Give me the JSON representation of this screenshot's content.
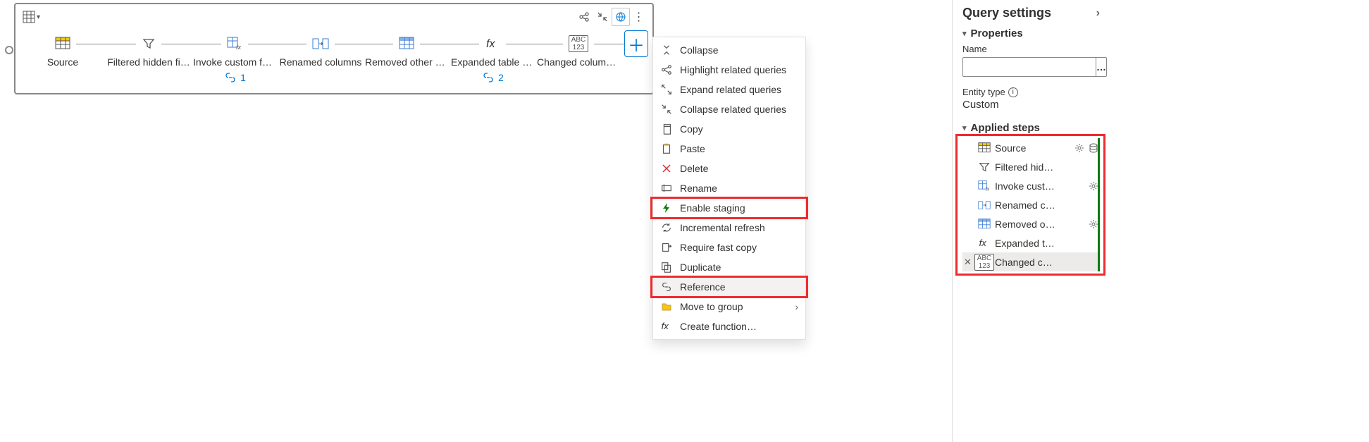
{
  "diagram": {
    "steps": [
      {
        "label": "Source",
        "icon": "table-yellow"
      },
      {
        "label": "Filtered hidden fi…",
        "icon": "filter"
      },
      {
        "label": "Invoke custom fu…",
        "icon": "table-fx",
        "badge": "1"
      },
      {
        "label": "Renamed columns",
        "icon": "rename-cols"
      },
      {
        "label": "Removed other c…",
        "icon": "table-blue"
      },
      {
        "label": "Expanded table c…",
        "icon": "fx",
        "badge": "2"
      },
      {
        "label": "Changed column…",
        "icon": "abc123-selected"
      }
    ]
  },
  "menu": {
    "items": [
      {
        "label": "Collapse",
        "icon": "collapse"
      },
      {
        "label": "Highlight related queries",
        "icon": "highlight-related"
      },
      {
        "label": "Expand related queries",
        "icon": "expand-related"
      },
      {
        "label": "Collapse related queries",
        "icon": "collapse-related"
      },
      {
        "label": "Copy",
        "icon": "copy"
      },
      {
        "label": "Paste",
        "icon": "paste"
      },
      {
        "label": "Delete",
        "icon": "delete",
        "color": "#d13438"
      },
      {
        "label": "Rename",
        "icon": "rename"
      },
      {
        "label": "Enable staging",
        "icon": "bolt",
        "color": "#107c10",
        "highlight": true
      },
      {
        "label": "Incremental refresh",
        "icon": "refresh"
      },
      {
        "label": "Require fast copy",
        "icon": "fastcopy"
      },
      {
        "label": "Duplicate",
        "icon": "duplicate"
      },
      {
        "label": "Reference",
        "icon": "reference",
        "highlight": true,
        "hover": true
      },
      {
        "label": "Move to group",
        "icon": "folder",
        "submenu": true,
        "color": "#ca9b3f"
      },
      {
        "label": "Create function…",
        "icon": "fx"
      }
    ]
  },
  "panel": {
    "title": "Query settings",
    "properties_label": "Properties",
    "name_label": "Name",
    "name_value": "",
    "entity_type_label": "Entity type",
    "entity_type_value": "Custom",
    "applied_steps_label": "Applied steps",
    "applied_steps": [
      {
        "label": "Source",
        "icon": "table-yellow",
        "gear": true,
        "db": true
      },
      {
        "label": "Filtered hid…",
        "icon": "filter"
      },
      {
        "label": "Invoke cust…",
        "icon": "table-fx",
        "gear": true
      },
      {
        "label": "Renamed c…",
        "icon": "rename-cols"
      },
      {
        "label": "Removed o…",
        "icon": "table-blue",
        "gear": true
      },
      {
        "label": "Expanded t…",
        "icon": "fx"
      },
      {
        "label": "Changed c…",
        "icon": "abc123",
        "selected": true,
        "del": true
      }
    ]
  }
}
